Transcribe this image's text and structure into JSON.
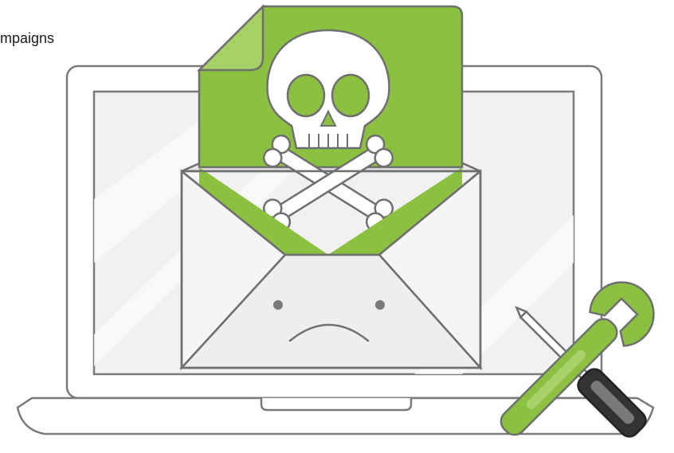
{
  "caption": {
    "text": "mpaigns"
  },
  "colors": {
    "green": "#8bc040",
    "green_dark": "#7aaa35",
    "outline": "#6f6f6f",
    "screen_bg": "#f1f1f1",
    "envelope_fill": "#f3f3f3",
    "tool_handle": "#333333"
  },
  "icons": [
    "laptop-icon",
    "envelope-icon",
    "document-icon",
    "skull-and-crossbones-icon",
    "sad-face-icon",
    "screwdriver-icon",
    "wrench-icon"
  ]
}
